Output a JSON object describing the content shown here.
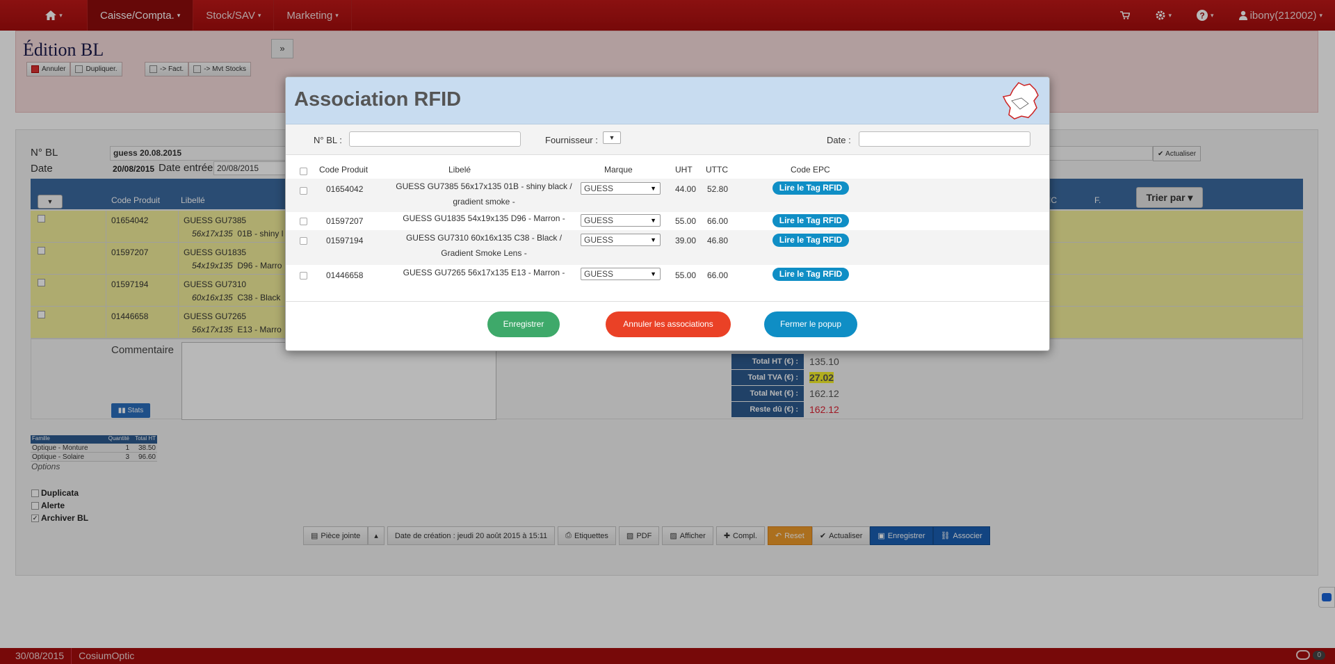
{
  "nav": {
    "home_caret": "▾",
    "items": [
      {
        "label": "Caisse/Compta."
      },
      {
        "label": "Stock/SAV"
      },
      {
        "label": "Marketing"
      }
    ],
    "user": "ibony(212002)"
  },
  "header": {
    "title": "Édition BL",
    "expand": "»",
    "actions": [
      "Annuler",
      "Dupliquer.",
      "-> Fact.",
      "-> Mvt Stocks"
    ]
  },
  "form": {
    "bl_label": "N° BL",
    "bl_value": "guess 20.08.2015",
    "date_label": "Date",
    "date_value": "20/08/2015",
    "date_entree_label": "Date entrée",
    "date_entree_value": "20/08/2015",
    "refresh_label": "Actualiser"
  },
  "grid": {
    "columns": [
      "Code Produit",
      "Libellé",
      "IC",
      "F."
    ],
    "sort_label": "Trier par",
    "rows": [
      {
        "code": "01654042",
        "name": "GUESS GU7385",
        "dims": "56x17x135",
        "rest": "01B - shiny l"
      },
      {
        "code": "01597207",
        "name": "GUESS GU1835",
        "dims": "54x19x135",
        "rest": "D96 - Marro"
      },
      {
        "code": "01597194",
        "name": "GUESS GU7310",
        "dims": "60x16x135",
        "rest": "C38 - Black"
      },
      {
        "code": "01446658",
        "name": "GUESS GU7265",
        "dims": "56x17x135",
        "rest": "E13 - Marro"
      }
    ]
  },
  "comment_label": "Commentaire",
  "stats_label": "Stats",
  "totals": [
    {
      "label": "Total HT (€) :",
      "value": "135.10"
    },
    {
      "label": "Total TVA (€) :",
      "value": "27.02"
    },
    {
      "label": "Total Net (€) :",
      "value": "162.12"
    },
    {
      "label": "Reste dû (€) :",
      "value": "162.12"
    }
  ],
  "families": {
    "headers": [
      "Famille",
      "Quantité",
      "Total HT"
    ],
    "rows": [
      {
        "name": "Optique - Monture",
        "qty": "1",
        "total": "38.50"
      },
      {
        "name": "Optique - Solaire",
        "qty": "3",
        "total": "96.60"
      }
    ]
  },
  "options": {
    "label": "Options",
    "checks": [
      {
        "label": "Duplicata",
        "checked": ""
      },
      {
        "label": "Alerte",
        "checked": ""
      },
      {
        "label": "Archiver BL",
        "checked": "✓"
      }
    ]
  },
  "bottom_buttons": {
    "piece_jointe": "Pièce jointe",
    "date_creation": "Date de création : jeudi 20 août 2015 à 15:11",
    "etiquettes": "Etiquettes",
    "pdf": "PDF",
    "afficher": "Afficher",
    "compl": "Compl.",
    "reset": "Reset",
    "actualiser": "Actualiser",
    "enregistrer": "Enregistrer",
    "associer": "Associer"
  },
  "statusbar": {
    "date": "30/08/2015",
    "app": "CosiumOptic",
    "chat_count": "0"
  },
  "modal": {
    "title": "Association RFID",
    "filters": {
      "bl_label": "N° BL :",
      "fournisseur_label": "Fournisseur :",
      "fournisseur_value": "▼",
      "date_label": "Date :"
    },
    "columns": {
      "code": "Code Produit",
      "libele": "Libelé",
      "marque": "Marque",
      "uht": "UHT",
      "uttc": "UTTC",
      "epc": "Code EPC"
    },
    "rows": [
      {
        "code": "01654042",
        "name": "GUESS GU7385 56x17x135 01B - shiny black / gradient smoke -",
        "brand": "GUESS",
        "uht": "44.00",
        "uttc": "52.80",
        "btn": "Lire le Tag RFID"
      },
      {
        "code": "01597207",
        "name": "GUESS GU1835 54x19x135 D96 - Marron -",
        "brand": "GUESS",
        "uht": "55.00",
        "uttc": "66.00",
        "btn": "Lire le Tag RFID"
      },
      {
        "code": "01597194",
        "name": "GUESS GU7310 60x16x135 C38 - Black / Gradient Smoke Lens -",
        "brand": "GUESS",
        "uht": "39.00",
        "uttc": "46.80",
        "btn": "Lire le Tag RFID"
      },
      {
        "code": "01446658",
        "name": "GUESS GU7265 56x17x135 E13 - Marron -",
        "brand": "GUESS",
        "uht": "55.00",
        "uttc": "66.00",
        "btn": "Lire le Tag RFID"
      }
    ],
    "buttons": {
      "save": "Enregistrer",
      "cancel_assoc": "Annuler les associations",
      "close": "Fermer le popup"
    }
  }
}
